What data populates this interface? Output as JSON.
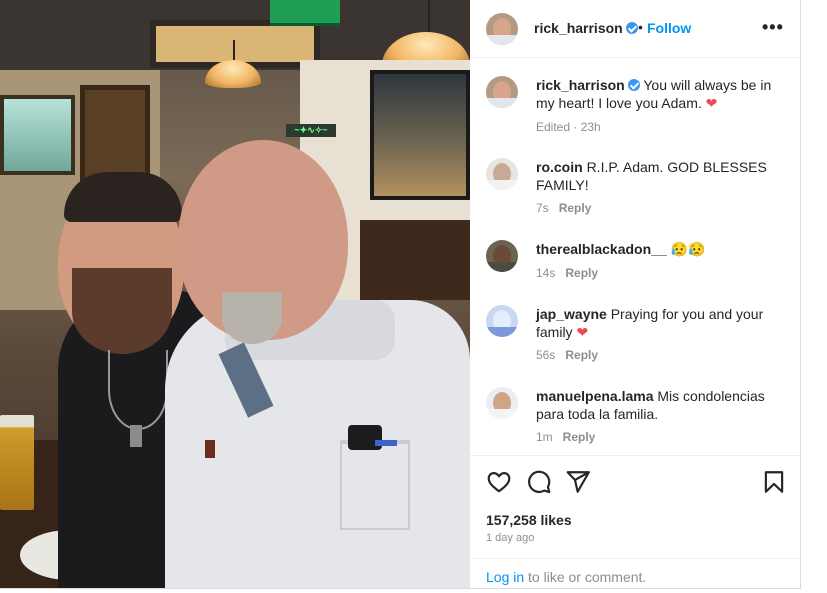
{
  "header": {
    "username": "rick_harrison",
    "separator": "•",
    "follow_label": "Follow",
    "more_icon": "more-horizontal-icon"
  },
  "caption": {
    "username": "rick_harrison",
    "text": "You will always be in my heart! I love you Adam.",
    "emoji": "❤",
    "meta": "Edited · 23h"
  },
  "comments": [
    {
      "username": "ro.coin",
      "text": "R.I.P. Adam. GOD BLESSES FAMILY!",
      "time": "7s",
      "reply": "Reply"
    },
    {
      "username": "therealblackadon__",
      "text": "😥😥",
      "time": "14s",
      "reply": "Reply"
    },
    {
      "username": "jap_wayne",
      "text": "Praying for you and your family",
      "emoji": "❤",
      "time": "56s",
      "reply": "Reply"
    },
    {
      "username": "manuelpena.lama",
      "text": "Mis condolencias para toda la familia.",
      "time": "1m",
      "reply": "Reply"
    }
  ],
  "actions": {
    "like_icon": "heart-icon",
    "comment_icon": "comment-icon",
    "share_icon": "share-icon",
    "save_icon": "bookmark-icon"
  },
  "likes": "157,258 likes",
  "posted": "1 day ago",
  "login": {
    "link": "Log in",
    "rest": "to like or comment."
  },
  "photo": {
    "neon_sign": "~✦∿✧~"
  },
  "colors": {
    "link": "#0095f6",
    "verified": "#3897f0",
    "heart": "#ed4956",
    "muted": "#8e8e8e"
  }
}
